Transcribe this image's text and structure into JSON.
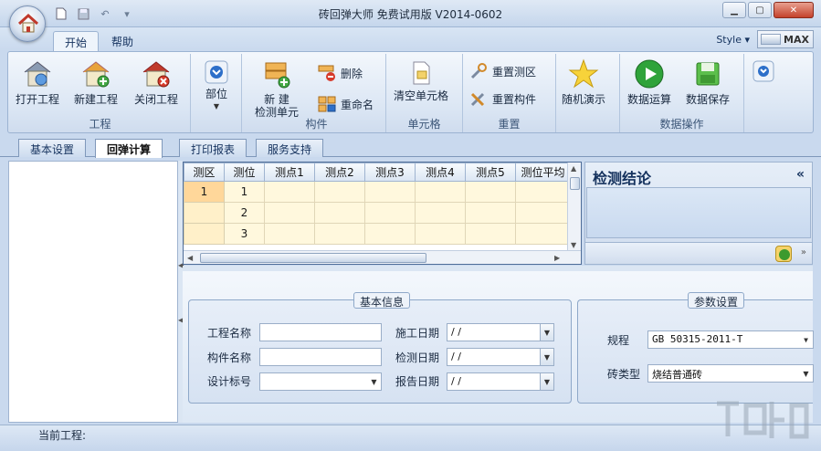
{
  "window": {
    "title": "砖回弹大师 免费试用版 V2014-0602"
  },
  "ribbon_tabs": [
    {
      "label": "开始"
    },
    {
      "label": "帮助"
    }
  ],
  "style_label": "Style",
  "max_label": "MAX",
  "groups": {
    "project": {
      "label": "工程",
      "open": "打开工程",
      "new": "新建工程",
      "close": "关闭工程"
    },
    "part": {
      "label": "部位"
    },
    "component": {
      "label": "构件",
      "new_line1": "新  建",
      "new_line2": "检测单元",
      "delete": "删除",
      "rename": "重命名"
    },
    "cell": {
      "label": "单元格",
      "clear": "清空单元格"
    },
    "reset": {
      "label": "重置",
      "reset_zone": "重置测区",
      "reset_component": "重置构件"
    },
    "demo": {
      "label": "随机演示"
    },
    "data": {
      "label": "数据操作",
      "compute": "数据运算",
      "save": "数据保存"
    }
  },
  "doc_tabs": [
    {
      "label": "基本设置"
    },
    {
      "label": "回弹计算"
    },
    {
      "label": "打印报表"
    },
    {
      "label": "服务支持"
    }
  ],
  "grid": {
    "columns": [
      "测区",
      "测位",
      "测点1",
      "测点2",
      "测点3",
      "测点4",
      "测点5",
      "测位平均"
    ],
    "rows": [
      {
        "zone": "1",
        "position": "1"
      },
      {
        "zone": "",
        "position": "2"
      },
      {
        "zone": "",
        "position": "3"
      }
    ]
  },
  "conclusion": {
    "title": "检测结论"
  },
  "basic_info": {
    "legend": "基本信息",
    "project_name_label": "工程名称",
    "component_name_label": "构件名称",
    "design_mark_label": "设计标号",
    "construction_date_label": "施工日期",
    "test_date_label": "检测日期",
    "report_date_label": "报告日期",
    "date_placeholder": "/  /"
  },
  "params": {
    "legend": "参数设置",
    "standard_label": "规程",
    "standard_value": "GB 50315-2011-T",
    "brick_type_label": "砖类型",
    "brick_type_value": "烧结普通砖"
  },
  "status": {
    "current_project_label": "当前工程:"
  },
  "colors": {
    "accent": "#15325e",
    "grid_cell": "#fff8dd",
    "grid_selected": "#ffd79a"
  }
}
